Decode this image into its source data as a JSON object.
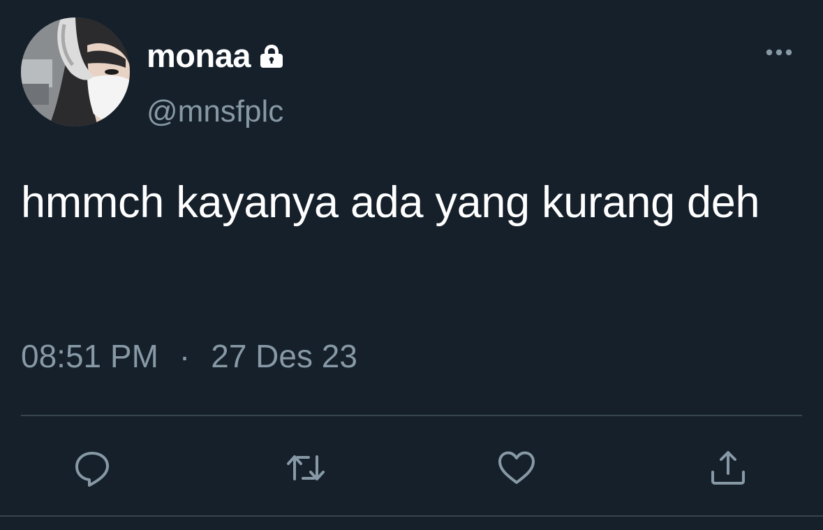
{
  "user": {
    "display_name": "monaa",
    "handle": "@mnsfplc",
    "protected_icon": "lock-icon",
    "avatar": "profile-photo"
  },
  "tweet": {
    "text": "hmmch kayanya ada yang kurang deh",
    "time": "08:51 PM",
    "separator": "·",
    "date": "27 Des 23"
  },
  "actions": [
    {
      "icon": "reply-icon"
    },
    {
      "icon": "retweet-icon"
    },
    {
      "icon": "like-icon"
    },
    {
      "icon": "share-icon"
    }
  ],
  "menu": {
    "icon": "more-options-icon"
  },
  "colors": {
    "background": "#15202b",
    "primary_text": "#ffffff",
    "secondary_text": "#8899a6",
    "divider": "#38444d"
  }
}
